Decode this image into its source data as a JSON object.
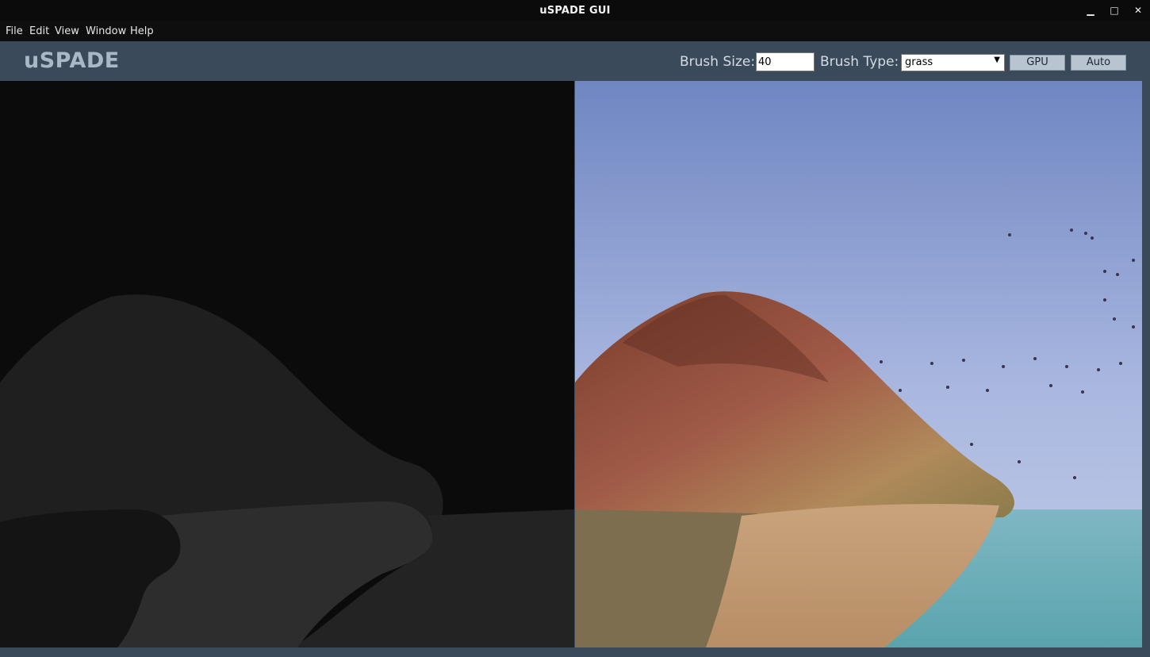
{
  "window": {
    "title": "uSPADE GUI",
    "minimize_glyph": "▁",
    "maximize_glyph": "□",
    "close_glyph": "✕"
  },
  "menu": [
    "File",
    "Edit",
    "View",
    "Window",
    "Help"
  ],
  "toolbar": {
    "brand": "uSPADE",
    "brush_size_label": "Brush Size:",
    "brush_size_value": "40",
    "brush_type_label": "Brush Type:",
    "brush_type_value": "grass",
    "gpu_button": "GPU",
    "auto_button": "Auto"
  },
  "colors": {
    "toolbar_bg": "#3b4a5a",
    "brand": "#a9b8c6",
    "seg_sky": "#0b0b0b",
    "seg_mountain": "#1f1f1f",
    "seg_sand": "#2d2d2d",
    "seg_sea": "#232323",
    "seg_rock": "#141414"
  },
  "icons": {
    "brush_type_dropdown": "chevron-down-icon",
    "minimize": "minimize-icon",
    "maximize": "maximize-icon",
    "close": "close-icon"
  }
}
